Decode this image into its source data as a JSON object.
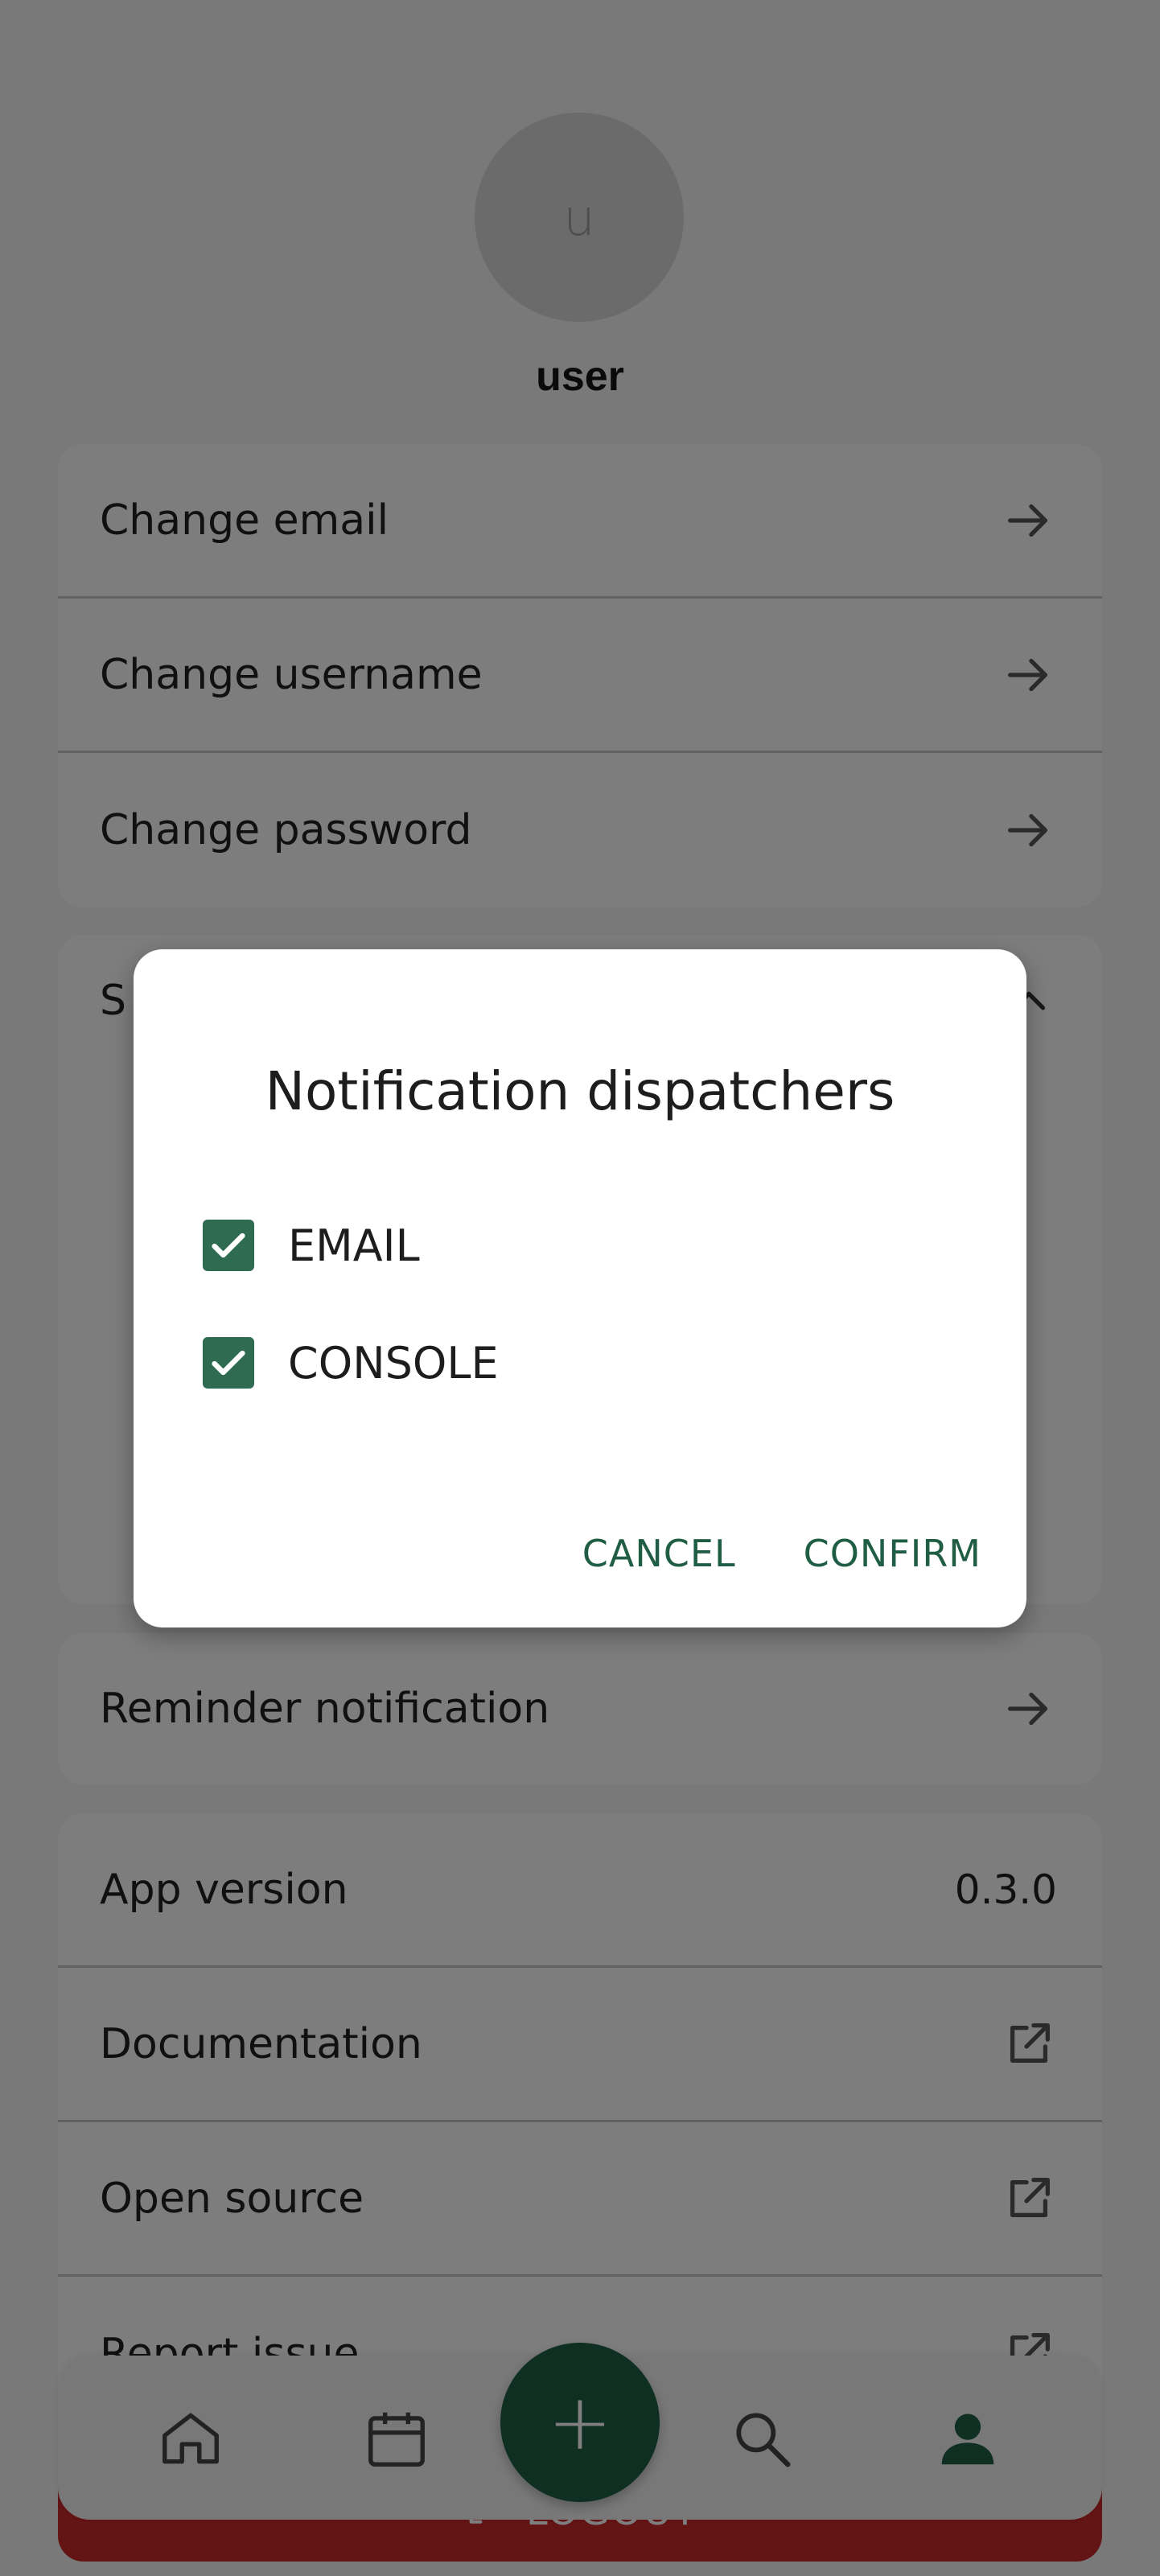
{
  "profile": {
    "avatar_initial": "u",
    "username": "user"
  },
  "account": {
    "items": [
      {
        "label": "Change email",
        "icon": "arrow-right-icon"
      },
      {
        "label": "Change username",
        "icon": "arrow-right-icon"
      },
      {
        "label": "Change password",
        "icon": "arrow-right-icon"
      }
    ]
  },
  "settings": {
    "header_label_partial": "S",
    "expanded": true
  },
  "reminder": {
    "label": "Reminder notification"
  },
  "info": {
    "app_version_label": "App version",
    "app_version_value": "0.3.0",
    "links": [
      {
        "label": "Documentation",
        "icon": "external-link-icon"
      },
      {
        "label": "Open source",
        "icon": "external-link-icon"
      },
      {
        "label": "Report issue",
        "icon": "external-link-icon"
      }
    ]
  },
  "logout": {
    "label": "LOGOUT"
  },
  "nav": {
    "items": [
      "home-icon",
      "calendar-icon",
      "add-icon",
      "search-icon",
      "profile-icon"
    ],
    "active": "profile-icon",
    "fab_label": "+"
  },
  "dialog": {
    "title": "Notification dispatchers",
    "options": [
      {
        "label": "EMAIL",
        "checked": true
      },
      {
        "label": "CONSOLE",
        "checked": true
      }
    ],
    "cancel_label": "CANCEL",
    "confirm_label": "CONFIRM"
  },
  "colors": {
    "accent": "#1f5e45",
    "checkbox": "#2f6b50",
    "logout": "#c62828",
    "scrim": "rgba(0,0,0,0.5)"
  }
}
